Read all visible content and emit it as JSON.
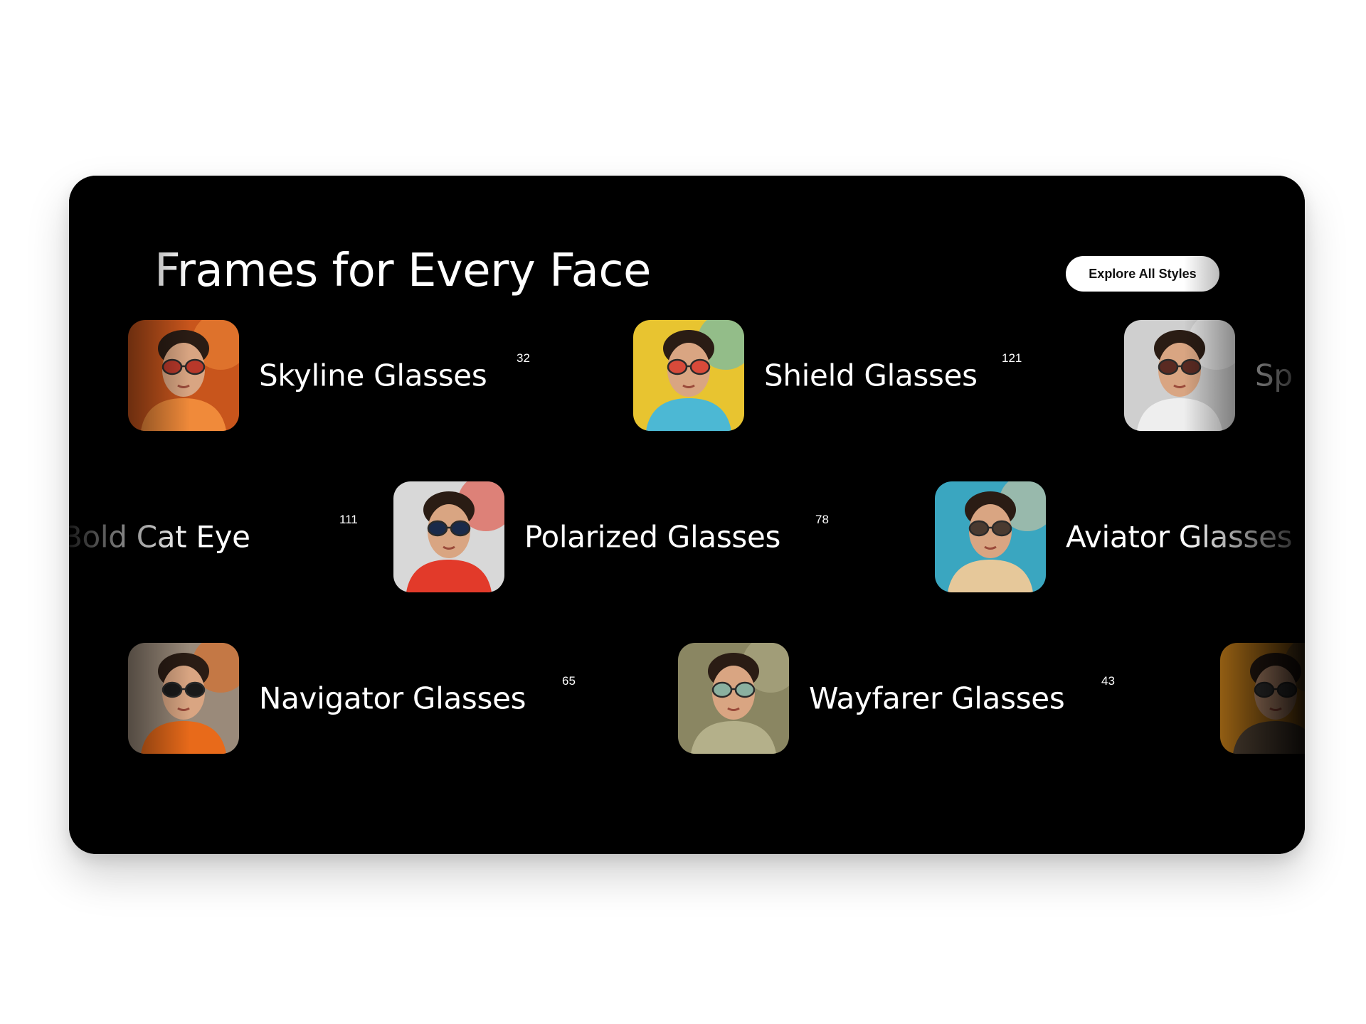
{
  "section": {
    "title": "Frames for Every Face",
    "cta_label": "Explore All Styles"
  },
  "rows": [
    {
      "items": [
        {
          "name": "Skyline Glasses",
          "count": "32",
          "bg": "#c8551c",
          "accent": "#f08a3a",
          "lens": "#b8382a"
        },
        {
          "name": "Shield Glasses",
          "count": "121",
          "bg": "#e8c430",
          "accent": "#4cb8d4",
          "lens": "#d84a3a"
        },
        {
          "name": "Sp",
          "count": "",
          "bg": "#cfcfcf",
          "accent": "#eeeeee",
          "lens": "#5a2a22"
        }
      ]
    },
    {
      "items": [
        {
          "name": "Bold Cat Eye",
          "count": "111"
        },
        {
          "name": "Polarized Glasses",
          "count": "78",
          "bg": "#d8d8d8",
          "accent": "#e23a2a",
          "lens": "#1a2a4a"
        },
        {
          "name": "Aviator Glasses",
          "count": "",
          "bg": "#3aa6c0",
          "accent": "#e6c89a",
          "lens": "#4a3a30"
        }
      ]
    },
    {
      "items": [
        {
          "name": "Navigator Glasses",
          "count": "65",
          "bg": "#9a8a7a",
          "accent": "#e86a1a",
          "lens": "#1a1a1a"
        },
        {
          "name": "Wayfarer Glasses",
          "count": "43",
          "bg": "#8a8662",
          "accent": "#b4b08a",
          "lens": "#8ab0a0"
        },
        {
          "name": "",
          "count": "",
          "bg": "#c8801a",
          "accent": "#5a4a3a",
          "lens": "#3a3a3a"
        }
      ]
    }
  ],
  "colors": {
    "card_bg": "#000000",
    "page_bg": "#ffffff",
    "text": "#ffffff",
    "button_bg": "#ffffff",
    "button_text": "#111111"
  }
}
